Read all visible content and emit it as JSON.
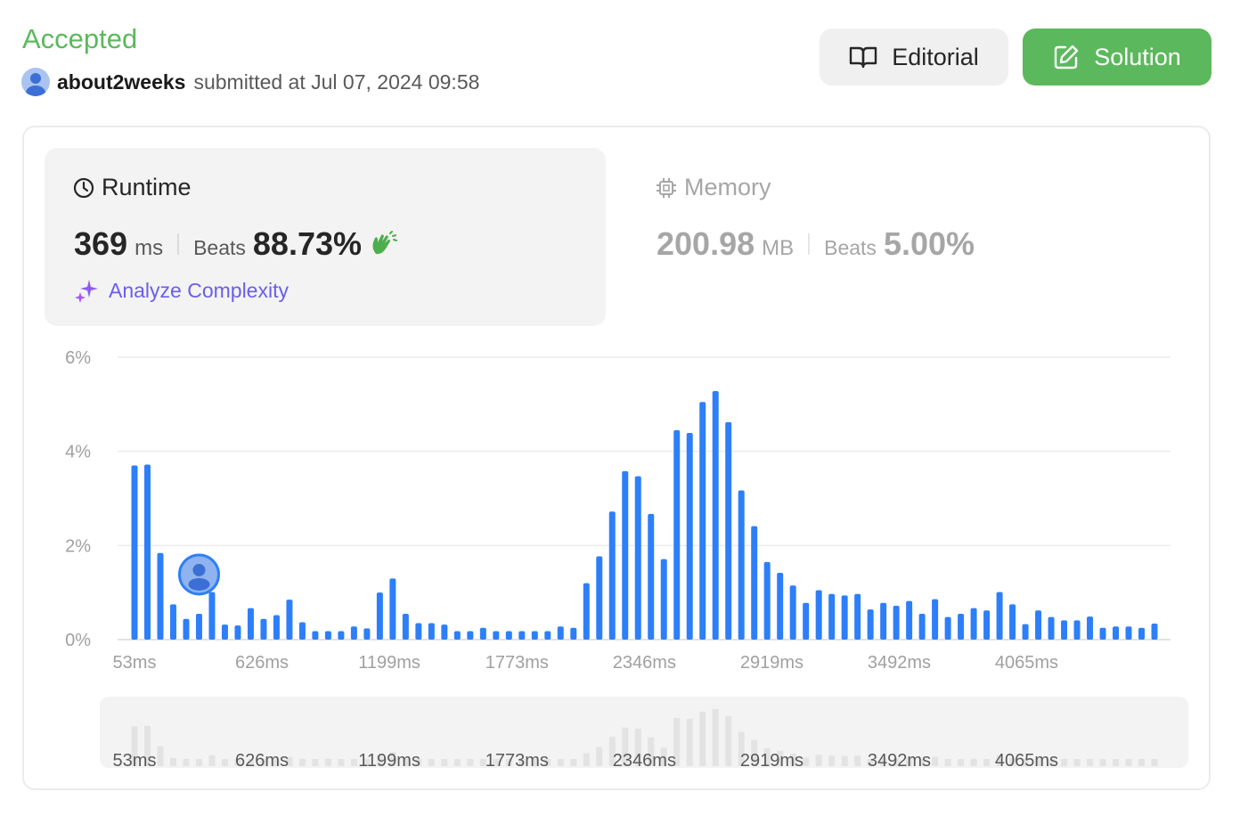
{
  "header": {
    "status": "Accepted",
    "username": "about2weeks",
    "submitted_text": "submitted at Jul 07, 2024 09:58",
    "editorial_label": "Editorial",
    "solution_label": "Solution"
  },
  "runtime": {
    "title": "Runtime",
    "value": "369",
    "unit": "ms",
    "beats_label": "Beats",
    "beats_value": "88.73%",
    "analyze_label": "Analyze Complexity"
  },
  "memory": {
    "title": "Memory",
    "value": "200.98",
    "unit": "MB",
    "beats_label": "Beats",
    "beats_value": "5.00%"
  },
  "colors": {
    "accepted": "#5cb85c",
    "bar": "#2d7ff9",
    "mini_bar": "#e3e3e3",
    "analyze": "#6a5fe8"
  },
  "chart_data": {
    "type": "bar",
    "ylim": [
      0,
      6
    ],
    "y_ticks": [
      "0%",
      "2%",
      "4%",
      "6%"
    ],
    "x_ticks": [
      "53ms",
      "626ms",
      "1199ms",
      "1773ms",
      "2346ms",
      "2919ms",
      "3492ms",
      "4065ms"
    ],
    "x_tick_values": [
      53,
      626,
      1199,
      1773,
      2346,
      2919,
      3492,
      4065
    ],
    "x_range": [
      53,
      4640
    ],
    "values": [
      3.7,
      3.72,
      1.84,
      0.75,
      0.44,
      0.55,
      1.01,
      0.32,
      0.3,
      0.67,
      0.44,
      0.52,
      0.85,
      0.37,
      0.18,
      0.18,
      0.18,
      0.28,
      0.24,
      1.0,
      1.3,
      0.55,
      0.35,
      0.35,
      0.32,
      0.18,
      0.18,
      0.25,
      0.18,
      0.18,
      0.18,
      0.18,
      0.18,
      0.28,
      0.25,
      1.2,
      1.77,
      2.72,
      3.58,
      3.47,
      2.67,
      1.71,
      4.45,
      4.39,
      5.05,
      5.28,
      4.62,
      3.17,
      2.41,
      1.65,
      1.42,
      1.15,
      0.78,
      1.05,
      0.97,
      0.94,
      0.97,
      0.64,
      0.78,
      0.72,
      0.82,
      0.55,
      0.86,
      0.48,
      0.55,
      0.67,
      0.62,
      1.01,
      0.75,
      0.33,
      0.62,
      0.48,
      0.41,
      0.41,
      0.49,
      0.25,
      0.28,
      0.28,
      0.25,
      0.34
    ],
    "highlight_index": 5,
    "grid": true
  }
}
